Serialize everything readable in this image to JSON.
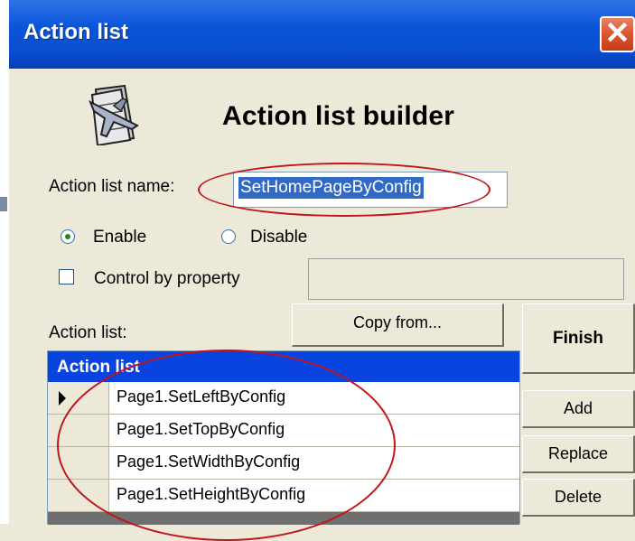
{
  "window": {
    "title": "Action list",
    "close_glyph": "✕"
  },
  "header": {
    "icon": "airplane-document-icon",
    "title": "Action list builder"
  },
  "form": {
    "name_label": "Action list name:",
    "name_value": "SetHomePageByConfig",
    "enable_label": "Enable",
    "disable_label": "Disable",
    "selected_state": "Enable",
    "control_label": "Control by property",
    "control_checked": false,
    "property_value": "",
    "action_list_label": "Action list:"
  },
  "buttons": {
    "copy_from": "Copy from...",
    "finish": "Finish",
    "add": "Add",
    "replace": "Replace",
    "delete": "Delete"
  },
  "grid": {
    "header": "Action list",
    "rows": [
      "Page1.SetLeftByConfig",
      "Page1.SetTopByConfig",
      "Page1.SetWidthByConfig",
      "Page1.SetHeightByConfig"
    ],
    "current_row": 0
  },
  "colors": {
    "titlebar": "#0a54d9",
    "grid_header": "#0a44e0",
    "selection": "#316ac5",
    "annotation_ellipse": "#c0151b"
  }
}
